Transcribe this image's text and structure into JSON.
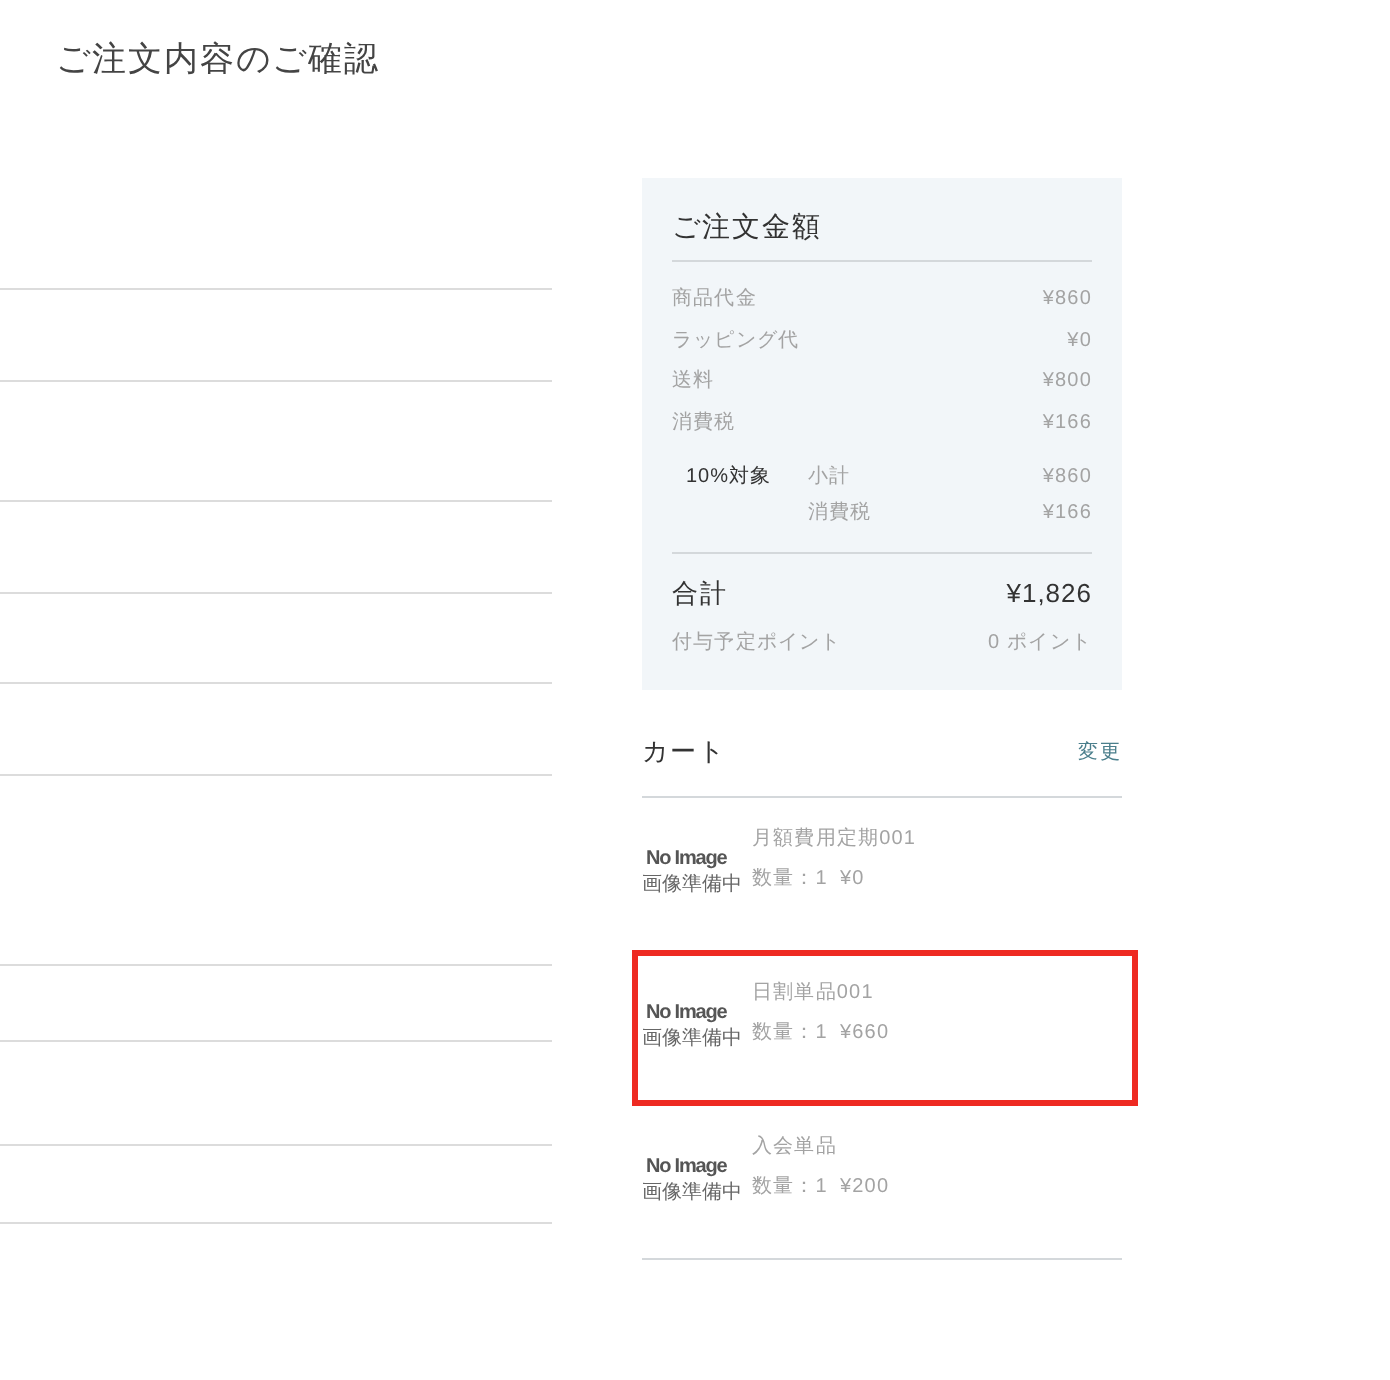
{
  "page": {
    "title": "ご注文内容のご確認"
  },
  "order_summary": {
    "title": "ご注文金額",
    "rows": [
      {
        "label": "商品代金",
        "value": "¥860"
      },
      {
        "label": "ラッピング代",
        "value": "¥0"
      },
      {
        "label": "送料",
        "value": "¥800"
      },
      {
        "label": "消費税",
        "value": "¥166"
      }
    ],
    "tax_breakdown": {
      "label": "10%対象",
      "rows": [
        {
          "label": "小計",
          "value": "¥860"
        },
        {
          "label": "消費税",
          "value": "¥166"
        }
      ]
    },
    "total": {
      "label": "合計",
      "value": "¥1,826"
    },
    "points": {
      "label": "付与予定ポイント",
      "value": "0 ポイント"
    }
  },
  "cart": {
    "title": "カート",
    "change_link": "変更",
    "items": [
      {
        "image_text": "No Image",
        "image_subtext": "画像準備中",
        "name": "月額費用定期001",
        "quantity": "数量：1",
        "price": "¥0",
        "highlighted": false
      },
      {
        "image_text": "No Image",
        "image_subtext": "画像準備中",
        "name": "日割単品001",
        "quantity": "数量：1",
        "price": "¥660",
        "highlighted": true
      },
      {
        "image_text": "No Image",
        "image_subtext": "画像準備中",
        "name": "入会単品",
        "quantity": "数量：1",
        "price": "¥200",
        "highlighted": false
      }
    ]
  }
}
